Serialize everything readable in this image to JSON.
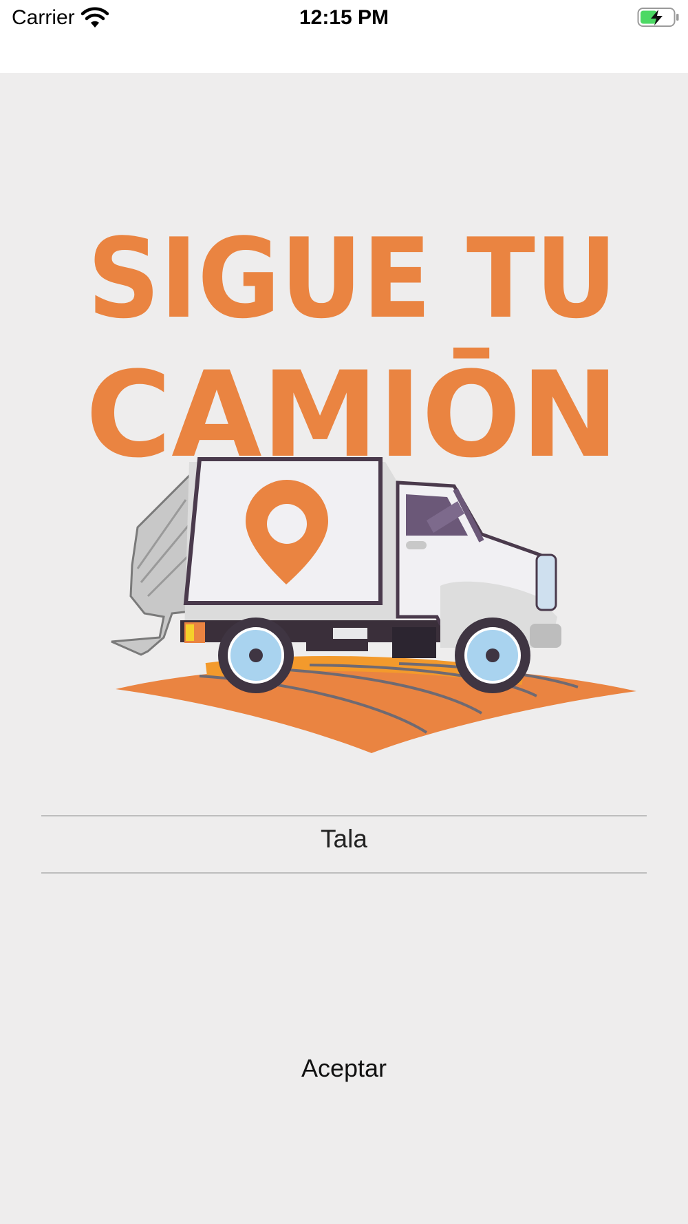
{
  "status_bar": {
    "carrier": "Carrier",
    "time": "12:15 PM",
    "wifi_icon": "wifi-icon",
    "battery_icon": "battery-charging-icon",
    "battery_color": "#4cd964"
  },
  "logo": {
    "line1": "SIGUE TU",
    "line2": "CAMIŌN",
    "brand_color": "#ea8441"
  },
  "picker": {
    "selected": "Tala"
  },
  "actions": {
    "accept_label": "Aceptar"
  },
  "colors": {
    "background": "#eeeded",
    "accent": "#ea8441"
  }
}
